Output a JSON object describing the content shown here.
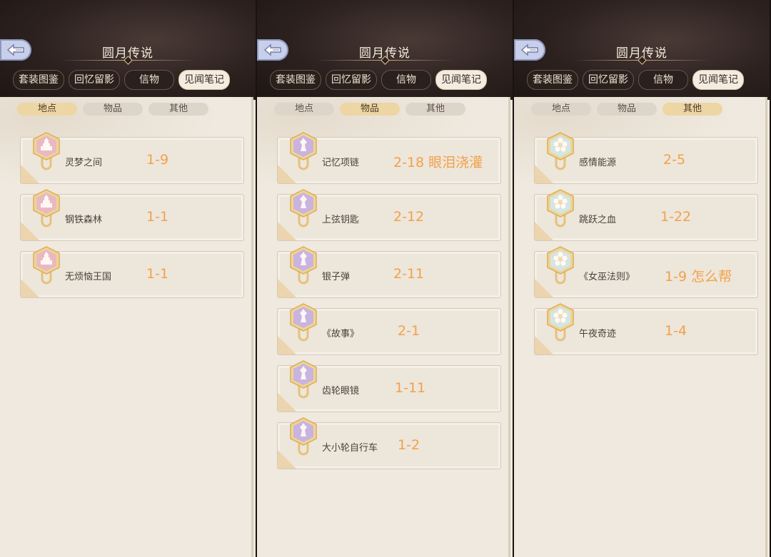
{
  "colors": {
    "accent_orange": "#f2a14a",
    "panel_bg": "#efe9df",
    "header_bg": "#2c211f",
    "badge_pink": "#e7b3bf",
    "badge_purple": "#c7b1df",
    "badge_teal": "#cfe5e7"
  },
  "panels": [
    {
      "title": "圆月传说",
      "tabs": [
        "套装图鉴",
        "回忆留影",
        "信物",
        "见闻笔记"
      ],
      "active_tab": 3,
      "subtabs": [
        "地点",
        "物品",
        "其他"
      ],
      "active_subtab": 0,
      "badge_icon": "castle-icon",
      "items": [
        {
          "name": "灵梦之间",
          "code": "1-9"
        },
        {
          "name": "钢铁森林",
          "code": "1-1"
        },
        {
          "name": "无烦恼王国",
          "code": "1-1"
        }
      ]
    },
    {
      "title": "圆月传说",
      "tabs": [
        "套装图鉴",
        "回忆留影",
        "信物",
        "见闻笔记"
      ],
      "active_tab": 3,
      "subtabs": [
        "地点",
        "物品",
        "其他"
      ],
      "active_subtab": 1,
      "badge_icon": "chess-piece-icon",
      "items": [
        {
          "name": "记忆项链",
          "code": "2-18 眼泪浇灌"
        },
        {
          "name": "上弦钥匙",
          "code": "2-12"
        },
        {
          "name": "银子弹",
          "code": "2-11"
        },
        {
          "name": "《故事》",
          "code": "2-1"
        },
        {
          "name": "齿轮眼镜",
          "code": "1-11"
        },
        {
          "name": "大小轮自行车",
          "code": "1-2"
        }
      ]
    },
    {
      "title": "圆月传说",
      "tabs": [
        "套装图鉴",
        "回忆留影",
        "信物",
        "见闻笔记"
      ],
      "active_tab": 3,
      "subtabs": [
        "地点",
        "物品",
        "其他"
      ],
      "active_subtab": 2,
      "badge_icon": "flower-icon",
      "items": [
        {
          "name": "感情能源",
          "code": "2-5"
        },
        {
          "name": "跳跃之血",
          "code": "1-22"
        },
        {
          "name": "《女巫法则》",
          "code": "1-9 怎么帮"
        },
        {
          "name": "午夜奇迹",
          "code": "1-4"
        }
      ]
    }
  ]
}
